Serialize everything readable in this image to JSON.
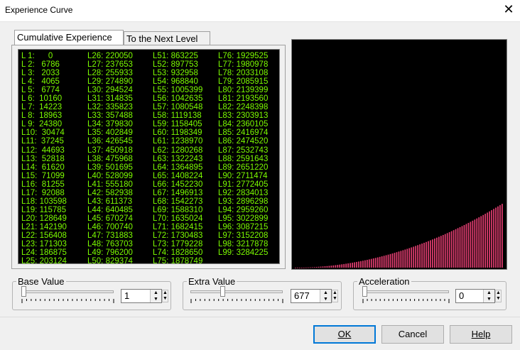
{
  "window": {
    "title": "Experience Curve",
    "close_glyph": "✕"
  },
  "tabs": [
    {
      "label": "Cumulative Experience",
      "active": true
    },
    {
      "label": "To the Next Level",
      "active": false
    }
  ],
  "levels": {
    "col1": [
      "L 1:      0",
      "L 2:   6786",
      "L 3:   2033",
      "L 4:   4065",
      "L 5:   6774",
      "L 6:  10160",
      "L 7:  14223",
      "L 8:  18963",
      "L 9:  24380",
      "L10:  30474",
      "L11:  37245",
      "L12:  44693",
      "L13:  52818",
      "L14:  61620",
      "L15:  71099",
      "L16:  81255",
      "L17:  92088",
      "L18: 103598",
      "L19: 115785",
      "L20: 128649",
      "L21: 142190",
      "L22: 156408",
      "L23: 171303",
      "L24: 186875",
      "L25: 203124"
    ],
    "col2": [
      "L26: 220050",
      "L27: 237653",
      "L28: 255933",
      "L29: 274890",
      "L30: 294524",
      "L31: 314835",
      "L32: 335823",
      "L33: 357488",
      "L34: 379830",
      "L35: 402849",
      "L36: 426545",
      "L37: 450918",
      "L38: 475968",
      "L39: 501695",
      "L40: 528099",
      "L41: 555180",
      "L42: 582938",
      "L43: 611373",
      "L44: 640485",
      "L45: 670274",
      "L46: 700740",
      "L47: 731883",
      "L48: 763703",
      "L49: 796200",
      "L50: 829374"
    ],
    "col3": [
      "L51: 863225",
      "L52: 897753",
      "L53: 932958",
      "L54: 968840",
      "L55: 1005399",
      "L56: 1042635",
      "L57: 1080548",
      "L58: 1119138",
      "L59: 1158405",
      "L60: 1198349",
      "L61: 1238970",
      "L62: 1280268",
      "L63: 1322243",
      "L64: 1364895",
      "L65: 1408224",
      "L66: 1452230",
      "L67: 1496913",
      "L68: 1542273",
      "L69: 1588310",
      "L70: 1635024",
      "L71: 1682415",
      "L72: 1730483",
      "L73: 1779228",
      "L74: 1828650",
      "L75: 1878749"
    ],
    "col4": [
      "L76: 1929525",
      "L77: 1980978",
      "L78: 2033108",
      "L79: 2085915",
      "L80: 2139399",
      "L81: 2193560",
      "L82: 2248398",
      "L83: 2303913",
      "L84: 2360105",
      "L85: 2416974",
      "L86: 2474520",
      "L87: 2532743",
      "L88: 2591643",
      "L89: 2651220",
      "L90: 2711474",
      "L91: 2772405",
      "L92: 2834013",
      "L93: 2896298",
      "L94: 2959260",
      "L95: 3022899",
      "L96: 3087215",
      "L97: 3152208",
      "L98: 3217878",
      "L99: 3284225"
    ]
  },
  "chart_data": {
    "type": "bar",
    "bar_color": "#dc3c6e",
    "background": "#000000",
    "values": [
      0,
      6786,
      2033,
      4065,
      6774,
      10160,
      14223,
      18963,
      24380,
      30474,
      37245,
      44693,
      52818,
      61620,
      71099,
      81255,
      92088,
      103598,
      115785,
      128649,
      142190,
      156408,
      171303,
      186875,
      203124,
      220050,
      237653,
      255933,
      274890,
      294524,
      314835,
      335823,
      357488,
      379830,
      402849,
      426545,
      450918,
      475968,
      501695,
      528099,
      555180,
      582938,
      611373,
      640485,
      670274,
      700740,
      731883,
      763703,
      796200,
      829374,
      863225,
      897753,
      932958,
      968840,
      1005399,
      1042635,
      1080548,
      1119138,
      1158405,
      1198349,
      1238970,
      1280268,
      1322243,
      1364895,
      1408224,
      1452230,
      1496913,
      1542273,
      1588310,
      1635024,
      1682415,
      1730483,
      1779228,
      1828650,
      1878749,
      1929525,
      1980978,
      2033108,
      2085915,
      2139399,
      2193560,
      2248398,
      2303913,
      2360105,
      2416974,
      2474520,
      2532743,
      2591643,
      2651220,
      2711474,
      2772405,
      2834013,
      2896298,
      2959260,
      3022899,
      3087215,
      3152208,
      3217878,
      3284225
    ],
    "ylim": [
      0,
      11800000
    ]
  },
  "controls": {
    "base": {
      "label": "Base Value",
      "value": "1",
      "slider": 0.0
    },
    "extra": {
      "label": "Extra Value",
      "value": "677",
      "slider": 0.34
    },
    "accel": {
      "label": "Acceleration",
      "value": "0",
      "slider": 0.0
    }
  },
  "buttons": {
    "ok": "OK",
    "cancel": "Cancel",
    "help": "Help"
  },
  "glyphs": {
    "up": "▲",
    "down": "▼"
  }
}
